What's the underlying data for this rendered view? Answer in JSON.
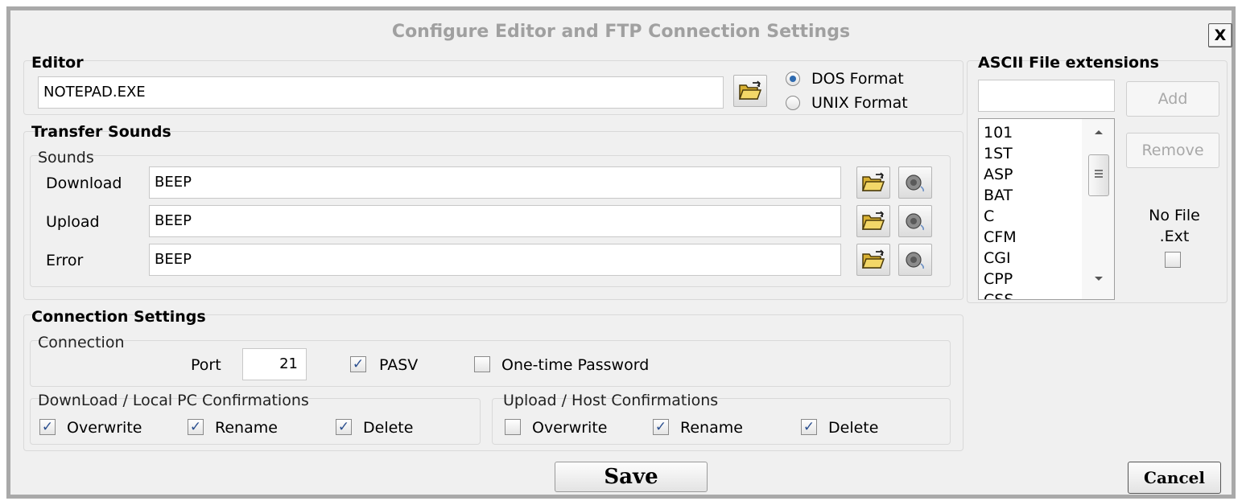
{
  "dialog": {
    "title": "Configure Editor and FTP Connection Settings",
    "close_label": "X"
  },
  "editor": {
    "group_title": "Editor",
    "path_value": "NOTEPAD.EXE",
    "format_options": [
      {
        "label": "DOS Format",
        "selected": true
      },
      {
        "label": "UNIX Format",
        "selected": false
      }
    ]
  },
  "sounds": {
    "group_title": "Transfer Sounds",
    "sub_title": "Sounds",
    "rows": [
      {
        "label": "Download",
        "value": "BEEP"
      },
      {
        "label": "Upload",
        "value": "BEEP"
      },
      {
        "label": "Error",
        "value": "BEEP"
      }
    ]
  },
  "ascii": {
    "group_title": "ASCII File extensions",
    "input_value": "",
    "add_label": "Add",
    "remove_label": "Remove",
    "extensions": [
      "101",
      "1ST",
      "ASP",
      "BAT",
      "C",
      "CFM",
      "CGI",
      "CPP",
      "CSS"
    ],
    "no_ext_line1": "No File",
    "no_ext_line2": ".Ext",
    "no_ext_checked": false
  },
  "connection": {
    "group_title": "Connection Settings",
    "sub_title": "Connection",
    "port_label": "Port",
    "port_value": "21",
    "pasv_label": "PASV",
    "pasv_checked": true,
    "otp_label": "One-time Password",
    "otp_checked": false,
    "download_group": {
      "title": "DownLoad / Local PC Confirmations",
      "options": [
        {
          "label": "Overwrite",
          "checked": true
        },
        {
          "label": "Rename",
          "checked": true
        },
        {
          "label": "Delete",
          "checked": true
        }
      ]
    },
    "upload_group": {
      "title": "Upload / Host Confirmations",
      "options": [
        {
          "label": "Overwrite",
          "checked": false
        },
        {
          "label": "Rename",
          "checked": true
        },
        {
          "label": "Delete",
          "checked": true
        }
      ]
    }
  },
  "footer": {
    "save_label": "Save",
    "cancel_label": "Cancel"
  },
  "icons": {
    "folder": "folder-open-icon",
    "speaker": "speaker-icon",
    "check_mark": "✓"
  },
  "colors": {
    "title_gray": "#a0a0a0",
    "dialog_bg": "#f0f0f0",
    "radio_accent": "#2f6bb0",
    "check_accent": "#2b4f8f"
  }
}
